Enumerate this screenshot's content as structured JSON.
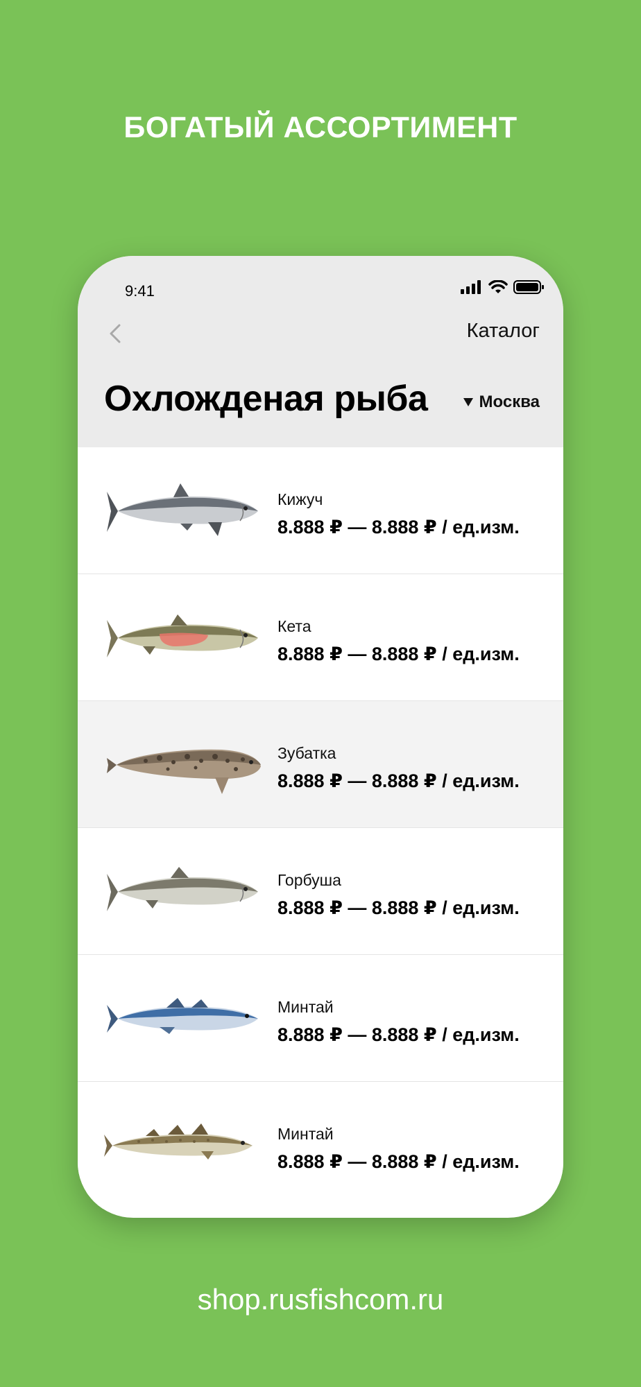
{
  "headline": "БОГАТЫЙ АССОРТИМЕНТ",
  "status_bar": {
    "time": "9:41",
    "icons": [
      "signal-icon",
      "wifi-icon",
      "battery-icon"
    ]
  },
  "nav": {
    "back_icon": "chevron-left-icon",
    "catalog_label": "Каталог"
  },
  "page": {
    "title": "Охложденая рыба",
    "city_icon": "triangle-down-icon",
    "city": "Москва"
  },
  "items": [
    {
      "name": "Кижуч",
      "price": "8.888 ₽ — 8.888 ₽  / ед.изм.",
      "image": "coho-salmon-image"
    },
    {
      "name": "Кета",
      "price": "8.888 ₽ — 8.888 ₽  / ед.изм.",
      "image": "chum-salmon-image"
    },
    {
      "name": "Зубатка",
      "price": "8.888 ₽ — 8.888 ₽  / ед.изм.",
      "image": "wolffish-image"
    },
    {
      "name": "Горбуша",
      "price": "8.888 ₽ — 8.888 ₽  / ед.изм.",
      "image": "pink-salmon-image"
    },
    {
      "name": "Минтай",
      "price": "8.888 ₽ — 8.888 ₽  / ед.изм.",
      "image": "pollock-image"
    },
    {
      "name": "Минтай",
      "price": "8.888 ₽ — 8.888 ₽  / ед.изм.",
      "image": "cod-image"
    }
  ],
  "footer": {
    "url": "shop.rusfishcom.ru"
  },
  "colors": {
    "background": "#7ac257",
    "header_bg": "#ebebeb",
    "highlight_row": "#f3f3f3"
  }
}
